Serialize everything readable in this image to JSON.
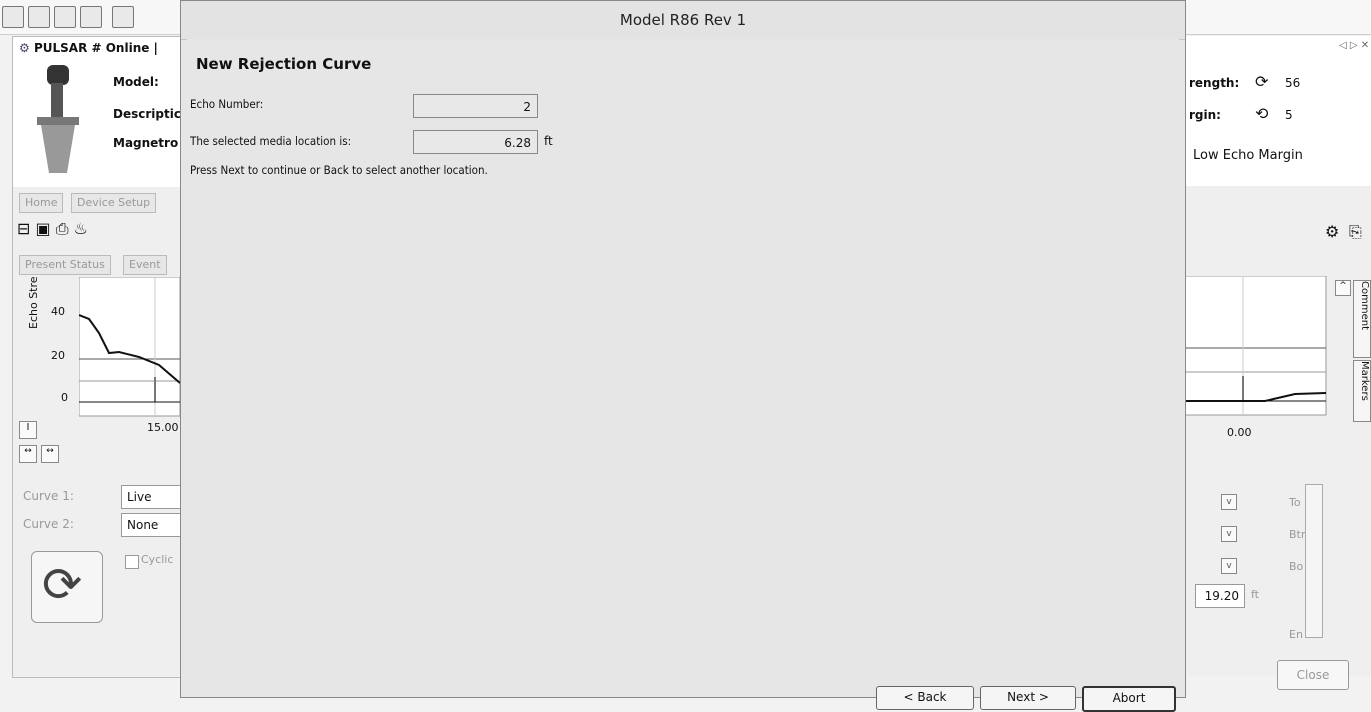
{
  "toolbar": {
    "icons": [
      "new-icon",
      "open-icon",
      "save-icon",
      "print-icon",
      "copy-icon"
    ]
  },
  "left": {
    "device_title": "PULSAR # Online |",
    "model_label": "Model:",
    "description_label": "Descriptic",
    "magnetrol_label": "Magnetro",
    "tabs": [
      "Home",
      "Device Setup"
    ],
    "status_tabs": [
      "Present Status",
      "Event"
    ],
    "chart": {
      "ylabel": "Echo Stre",
      "y_ticks": [
        "40",
        "20",
        "0"
      ],
      "x_tick": "15.00"
    },
    "curve1_label": "Curve 1:",
    "curve1_value": "Live",
    "curve2_label": "Curve 2:",
    "curve2_value": "None",
    "cyclic_label": "Cyclic"
  },
  "right": {
    "strength_label": "rength:",
    "strength_value": "56",
    "margin_label": "rgin:",
    "margin_value": "5",
    "low_echo": "Low Echo Margin",
    "x_tick": "0.00",
    "side_tabs": [
      "Comment",
      "Markers"
    ],
    "field_value": "19.20",
    "field_unit": "ft",
    "side_labels": [
      "To",
      "Btr",
      "Bo",
      "En"
    ],
    "close_button": "Close"
  },
  "dialog": {
    "title": "Model R86 Rev 1",
    "heading": "New Rejection Curve",
    "echo_label": "Echo Number:",
    "echo_value": "2",
    "location_label": "The selected media location is:",
    "location_value": "6.28",
    "location_unit": "ft",
    "instructions": "Press Next to continue or Back to select another location.",
    "buttons": {
      "back": "< Back",
      "next": "Next >",
      "abort": "Abort"
    }
  }
}
